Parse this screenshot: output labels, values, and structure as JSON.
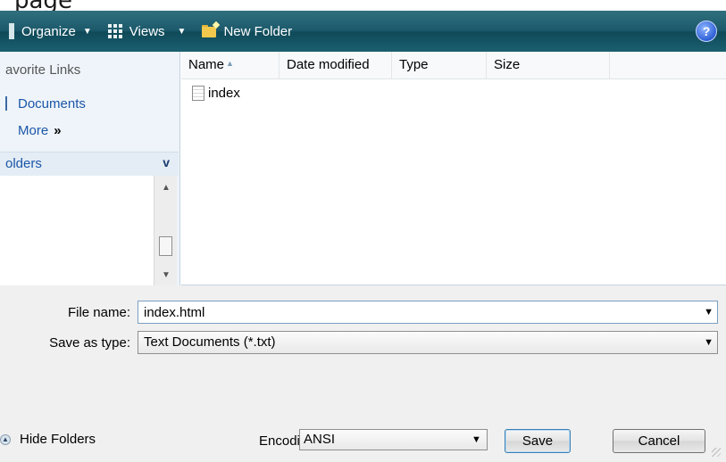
{
  "window": {
    "title_partial": "page"
  },
  "toolbar": {
    "organize_label": "Organize",
    "views_label": "Views",
    "new_folder_label": "New Folder",
    "help_symbol": "?"
  },
  "navigation": {
    "favorite_links_title": "avorite Links",
    "favorites": [
      {
        "label": "Documents"
      }
    ],
    "more_label": "More",
    "more_symbol": "»",
    "folders_label": "olders",
    "folders_chevron": "v"
  },
  "file_list": {
    "columns": [
      {
        "label": "Name"
      },
      {
        "label": "Date modified"
      },
      {
        "label": "Type"
      },
      {
        "label": "Size"
      }
    ],
    "files": [
      {
        "name": "index",
        "icon": "text-document-icon"
      }
    ]
  },
  "form": {
    "file_name_label": "File name:",
    "file_name_value": "index.html",
    "save_as_type_label": "Save as type:",
    "save_as_type_value": "Text Documents (*.txt)",
    "encoding_label": "Encoding:",
    "encoding_value": "ANSI"
  },
  "footer": {
    "hide_folders_label": "Hide Folders",
    "save_label": "Save",
    "cancel_label": "Cancel"
  },
  "colors": {
    "toolbar": "#1c5a6b",
    "link": "#1b56a8",
    "nav_background": "#eef4f9",
    "panel_background": "#f0f0f0"
  }
}
